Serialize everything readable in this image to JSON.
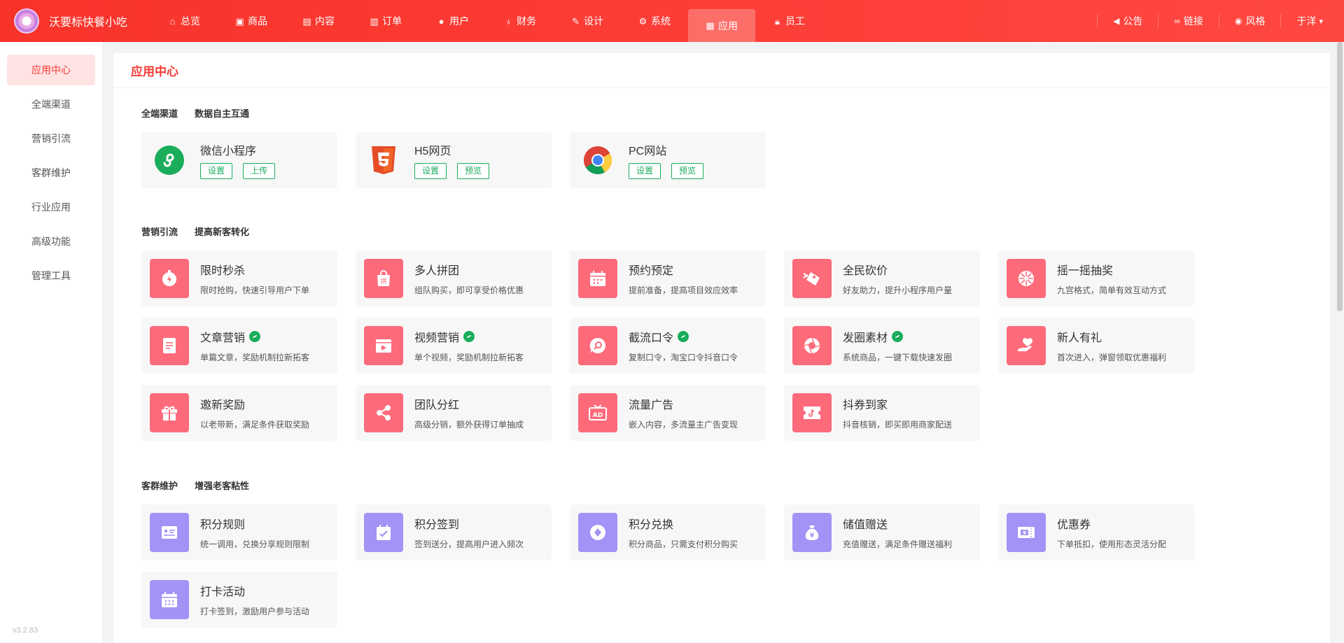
{
  "app": {
    "name": "沃要标快餐小吃"
  },
  "nav": [
    {
      "label": "总览",
      "icon": "home-icon"
    },
    {
      "label": "商品",
      "icon": "bag-icon"
    },
    {
      "label": "内容",
      "icon": "document-icon"
    },
    {
      "label": "订单",
      "icon": "clipboard-icon"
    },
    {
      "label": "用户",
      "icon": "user-icon"
    },
    {
      "label": "财务",
      "icon": "money-bag-icon"
    },
    {
      "label": "设计",
      "icon": "brush-icon"
    },
    {
      "label": "系统",
      "icon": "gear-icon"
    },
    {
      "label": "应用",
      "icon": "grid-icon",
      "active": true
    },
    {
      "label": "员工",
      "icon": "lock-icon"
    }
  ],
  "top_right": [
    {
      "label": "公告",
      "icon": "speaker-icon"
    },
    {
      "label": "链接",
      "icon": "link-icon"
    },
    {
      "label": "风格",
      "icon": "palette-icon"
    }
  ],
  "user": {
    "name": "于洋",
    "caret": "▾"
  },
  "sidebar": {
    "items": [
      {
        "label": "应用中心",
        "active": true
      },
      {
        "label": "全端渠道"
      },
      {
        "label": "营销引流"
      },
      {
        "label": "客群维护"
      },
      {
        "label": "行业应用"
      },
      {
        "label": "高级功能"
      },
      {
        "label": "管理工具"
      }
    ],
    "version": "v3.2.83"
  },
  "page": {
    "title": "应用中心"
  },
  "sections": [
    {
      "title": "全端渠道",
      "subtitle": "数据自主互通",
      "cards": [
        {
          "title": "微信小程序",
          "icon": "wechat-miniprogram-icon",
          "buttons": [
            "设置",
            "上传"
          ]
        },
        {
          "title": "H5网页",
          "icon": "html5-icon",
          "buttons": [
            "设置",
            "预览"
          ]
        },
        {
          "title": "PC网站",
          "icon": "chrome-icon",
          "buttons": [
            "设置",
            "预览"
          ]
        }
      ]
    },
    {
      "title": "营销引流",
      "subtitle": "提高新客转化",
      "cards": [
        {
          "title": "限时秒杀",
          "desc": "限时抢购，快速引导用户下单",
          "icon": "stopwatch-icon"
        },
        {
          "title": "多人拼团",
          "desc": "组队购买，即可享受价格优惠",
          "icon": "group-bag-icon"
        },
        {
          "title": "预约预定",
          "desc": "提前准备，提高项目效应效率",
          "icon": "calendar-icon"
        },
        {
          "title": "全民砍价",
          "desc": "好友助力，提升小程序用户量",
          "icon": "price-cut-icon"
        },
        {
          "title": "摇一摇抽奖",
          "desc": "九宫格式，简单有效互动方式",
          "icon": "lottery-wheel-icon"
        },
        {
          "title": "文章营销",
          "desc": "单篇文章，奖励机制拉新拓客",
          "icon": "article-icon",
          "tag": true
        },
        {
          "title": "视频营销",
          "desc": "单个视频，奖励机制拉新拓客",
          "icon": "video-icon",
          "tag": true
        },
        {
          "title": "截流口令",
          "desc": "复制口令，淘宝口令抖音口令",
          "icon": "search-bubble-icon",
          "tag": true
        },
        {
          "title": "发圈素材",
          "desc": "系统商品，一键下载快速发圈",
          "icon": "aperture-icon",
          "tag": true
        },
        {
          "title": "新人有礼",
          "desc": "首次进入，弹窗领取优惠福利",
          "icon": "heart-hand-icon"
        },
        {
          "title": "邀新奖励",
          "desc": "以老带新，满足条件获取奖励",
          "icon": "gift-icon"
        },
        {
          "title": "团队分红",
          "desc": "高级分销，额外获得订单抽成",
          "icon": "share-icon"
        },
        {
          "title": "流量广告",
          "desc": "嵌入内容，多流量主广告变现",
          "icon": "ad-icon"
        },
        {
          "title": "抖券到家",
          "desc": "抖音核销，即买即用商家配送",
          "icon": "douyin-ticket-icon"
        }
      ]
    },
    {
      "title": "客群维护",
      "subtitle": "增强老客粘性",
      "cards": [
        {
          "title": "积分规则",
          "desc": "统一调用，兑换分享规则限制",
          "icon": "rules-card-icon"
        },
        {
          "title": "积分签到",
          "desc": "签到送分，提高用户进入频次",
          "icon": "checkin-calendar-icon"
        },
        {
          "title": "积分兑换",
          "desc": "积分商品，只需支付积分购买",
          "icon": "diamond-icon"
        },
        {
          "title": "储值赠送",
          "desc": "充值赠送，满足条件赠送福利",
          "icon": "money-bag-icon"
        },
        {
          "title": "优惠券",
          "desc": "下单抵扣，使用形态灵活分配",
          "icon": "coupon-icon"
        },
        {
          "title": "打卡活动",
          "desc": "打卡签到，激励用户参与活动",
          "icon": "punch-calendar-icon"
        }
      ]
    }
  ]
}
